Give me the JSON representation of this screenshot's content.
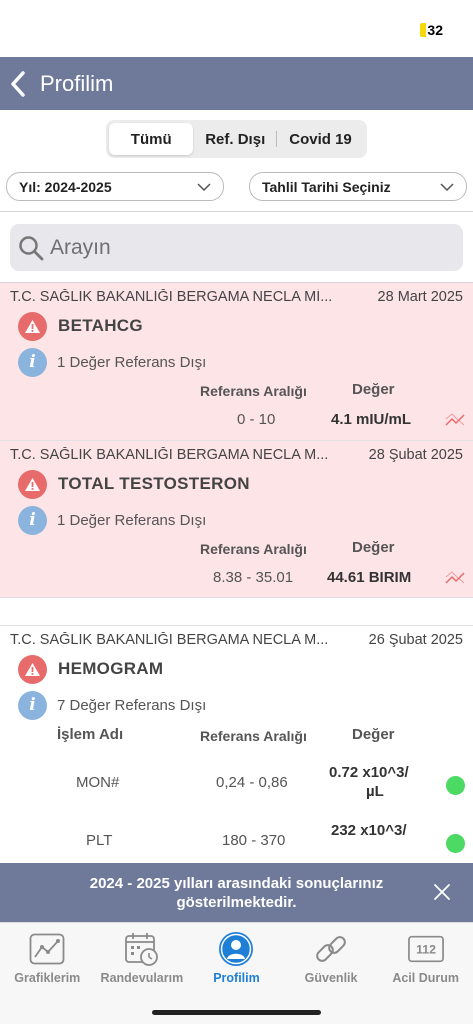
{
  "status_bar": {
    "battery": "32"
  },
  "nav": {
    "title": "Profilim"
  },
  "segments": [
    {
      "label": "Tümü",
      "active": true
    },
    {
      "label": "Ref. Dışı",
      "active": false
    },
    {
      "label": "Covid 19",
      "active": false
    }
  ],
  "filters": {
    "year": "Yıl: 2024-2025",
    "date": "Tahlil Tarihi Seçiniz"
  },
  "search": {
    "placeholder": "Arayın"
  },
  "columns": {
    "islem": "İşlem Adı",
    "ref": "Referans Aralığı",
    "deger": "Değer"
  },
  "results": [
    {
      "institution": "T.C. SAĞLIK BAKANLIĞI BERGAMA NECLA Mİ...",
      "date": "28 Mart 2025",
      "test": "BETAHCG",
      "info": "1 Değer Referans Dışı",
      "ref": "0 - 10",
      "value": "4.1 mIU/mL"
    },
    {
      "institution": "T.C. SAĞLIK BAKANLIĞI BERGAMA NECLA M...",
      "date": "28 Şubat 2025",
      "test": "TOTAL TESTOSTERON",
      "info": "1 Değer Referans Dışı",
      "ref": "8.38 - 35.01",
      "value": "44.61 BIRIM"
    },
    {
      "institution": "T.C. SAĞLIK BAKANLIĞI BERGAMA NECLA M...",
      "date": "26 Şubat 2025",
      "test": "HEMOGRAM",
      "info": "7 Değer Referans Dışı",
      "rows": [
        {
          "name": "MON#",
          "ref": "0,24 - 0,86",
          "value_line1": "0.72 x10^3/",
          "value_line2": "µL"
        },
        {
          "name": "PLT",
          "ref": "180 - 370",
          "value_line1": "232 x10^3/",
          "value_line2": ""
        }
      ]
    }
  ],
  "toast": {
    "text": "2024 - 2025 yılları arasındaki sonuçlarınız gösterilmektedir."
  },
  "tabs": [
    {
      "label": "Grafiklerim",
      "icon": "chart-icon"
    },
    {
      "label": "Randevularım",
      "icon": "calendar-icon"
    },
    {
      "label": "Profilim",
      "icon": "profile-icon",
      "active": true
    },
    {
      "label": "Güvenlik",
      "icon": "link-icon"
    },
    {
      "label": "Acil Durum",
      "icon": "emergency-112-icon",
      "badge": "112"
    }
  ],
  "colors": {
    "nav": "#6f7a9a",
    "alert_bg": "#fde4e6",
    "warn": "#e86b6b",
    "info": "#8ab3dd",
    "active_tab": "#1f7fd6",
    "ok_dot": "#4cd964"
  }
}
